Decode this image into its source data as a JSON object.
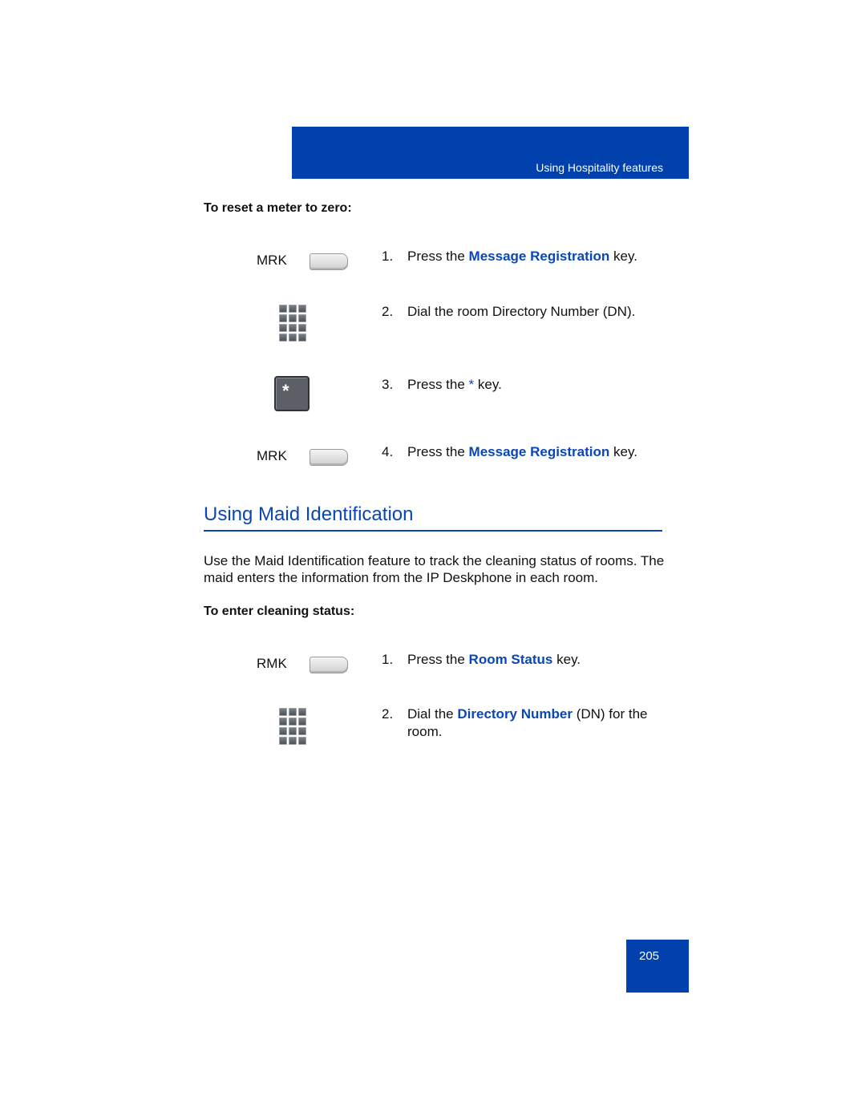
{
  "header": {
    "section": "Using Hospitality features"
  },
  "procedure_reset": {
    "title": "To reset a meter to zero:",
    "steps": [
      {
        "number": "1.",
        "key_label": "MRK",
        "icon": "soft-key-icon",
        "pre": "Press the ",
        "highlight": "Message Registration",
        "post": " key."
      },
      {
        "number": "2.",
        "icon": "dialpad-icon",
        "text": "Dial the room Directory Number (DN)."
      },
      {
        "number": "3.",
        "icon": "star-key-icon",
        "star_glyph": "*",
        "pre": "Press the ",
        "highlight": "*",
        "post": " key."
      },
      {
        "number": "4.",
        "key_label": "MRK",
        "icon": "soft-key-icon",
        "pre": "Press the ",
        "highlight": "Message Registration",
        "post": " key."
      }
    ]
  },
  "section": {
    "title": "Using Maid Identification",
    "paragraph": "Use the Maid Identification feature to track the cleaning status of rooms. The maid enters the information from the IP Deskphone in each room."
  },
  "procedure_cleaning": {
    "title": "To enter cleaning status:",
    "steps": [
      {
        "number": "1.",
        "key_label": "RMK",
        "icon": "soft-key-icon",
        "pre": "Press the ",
        "highlight": "Room Status",
        "post": " key."
      },
      {
        "number": "2.",
        "icon": "dialpad-icon",
        "pre": "Dial the ",
        "highlight": "Directory Number",
        "post": " (DN) for the",
        "line2": "room."
      }
    ]
  },
  "footer": {
    "page_number": "205"
  },
  "colors": {
    "brand_blue": "#0041ad",
    "link_blue": "#0a47b5"
  }
}
